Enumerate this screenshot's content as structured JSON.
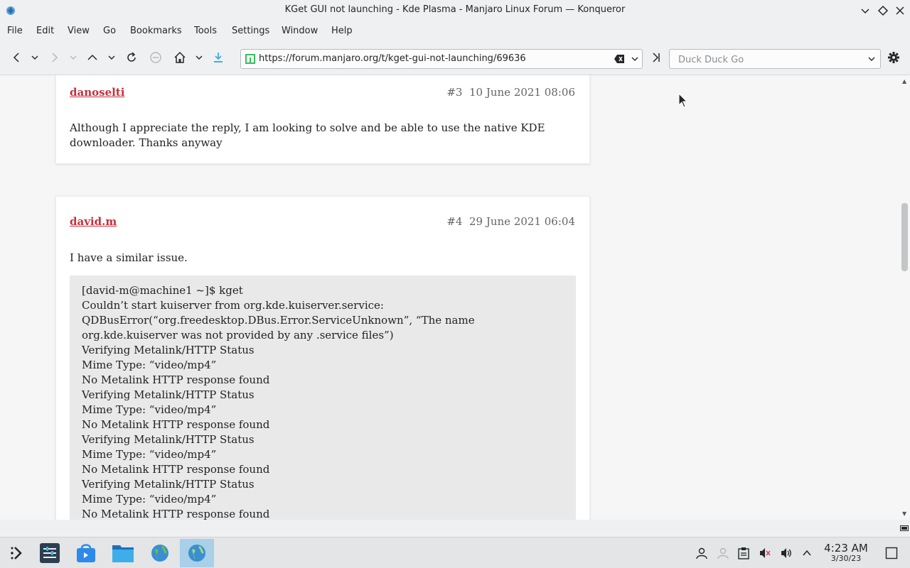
{
  "window": {
    "title": "KGet GUI not launching - Kde Plasma - Manjaro Linux Forum — Konqueror"
  },
  "menu": [
    "File",
    "Edit",
    "View",
    "Go",
    "Bookmarks",
    "Tools",
    "Settings",
    "Window",
    "Help"
  ],
  "toolbar": {
    "url": "https://forum.manjaro.org/t/kget-gui-not-launching/69636",
    "search_placeholder": "Duck Duck Go"
  },
  "posts": [
    {
      "author": "danoselti",
      "number": "#3",
      "date": "10 June 2021 08:06",
      "body": "Although I appreciate the reply, I am looking to solve and be able to use the native KDE downloader. Thanks anyway"
    },
    {
      "author": "david.m",
      "number": "#4",
      "date": "29 June 2021 06:04",
      "body": "I have a similar issue.",
      "code": [
        "[david-m@machine1 ~]$ kget",
        "Couldn’t start kuiserver from org.kde.kuiserver.service: QDBusError(“org.freedesktop.DBus.Error.ServiceUnknown”, “The name org.kde.kuiserver was not provided by any .service files”)",
        "Verifying Metalink/HTTP Status",
        "Mime Type: “video/mp4”",
        "No Metalink HTTP response found",
        "Verifying Metalink/HTTP Status",
        "Mime Type: “video/mp4”",
        "No Metalink HTTP response found",
        "Verifying Metalink/HTTP Status",
        "Mime Type: “video/mp4”",
        "No Metalink HTTP response found",
        "Verifying Metalink/HTTP Status",
        "Mime Type: “video/mp4”",
        "No Metalink HTTP response found"
      ]
    }
  ],
  "clock": {
    "time": "4:23 AM",
    "date": "3/30/23"
  },
  "colors": {
    "author": "#c4303c",
    "code_bg": "#e9e9e9",
    "active_task": "#a9cfe9"
  }
}
